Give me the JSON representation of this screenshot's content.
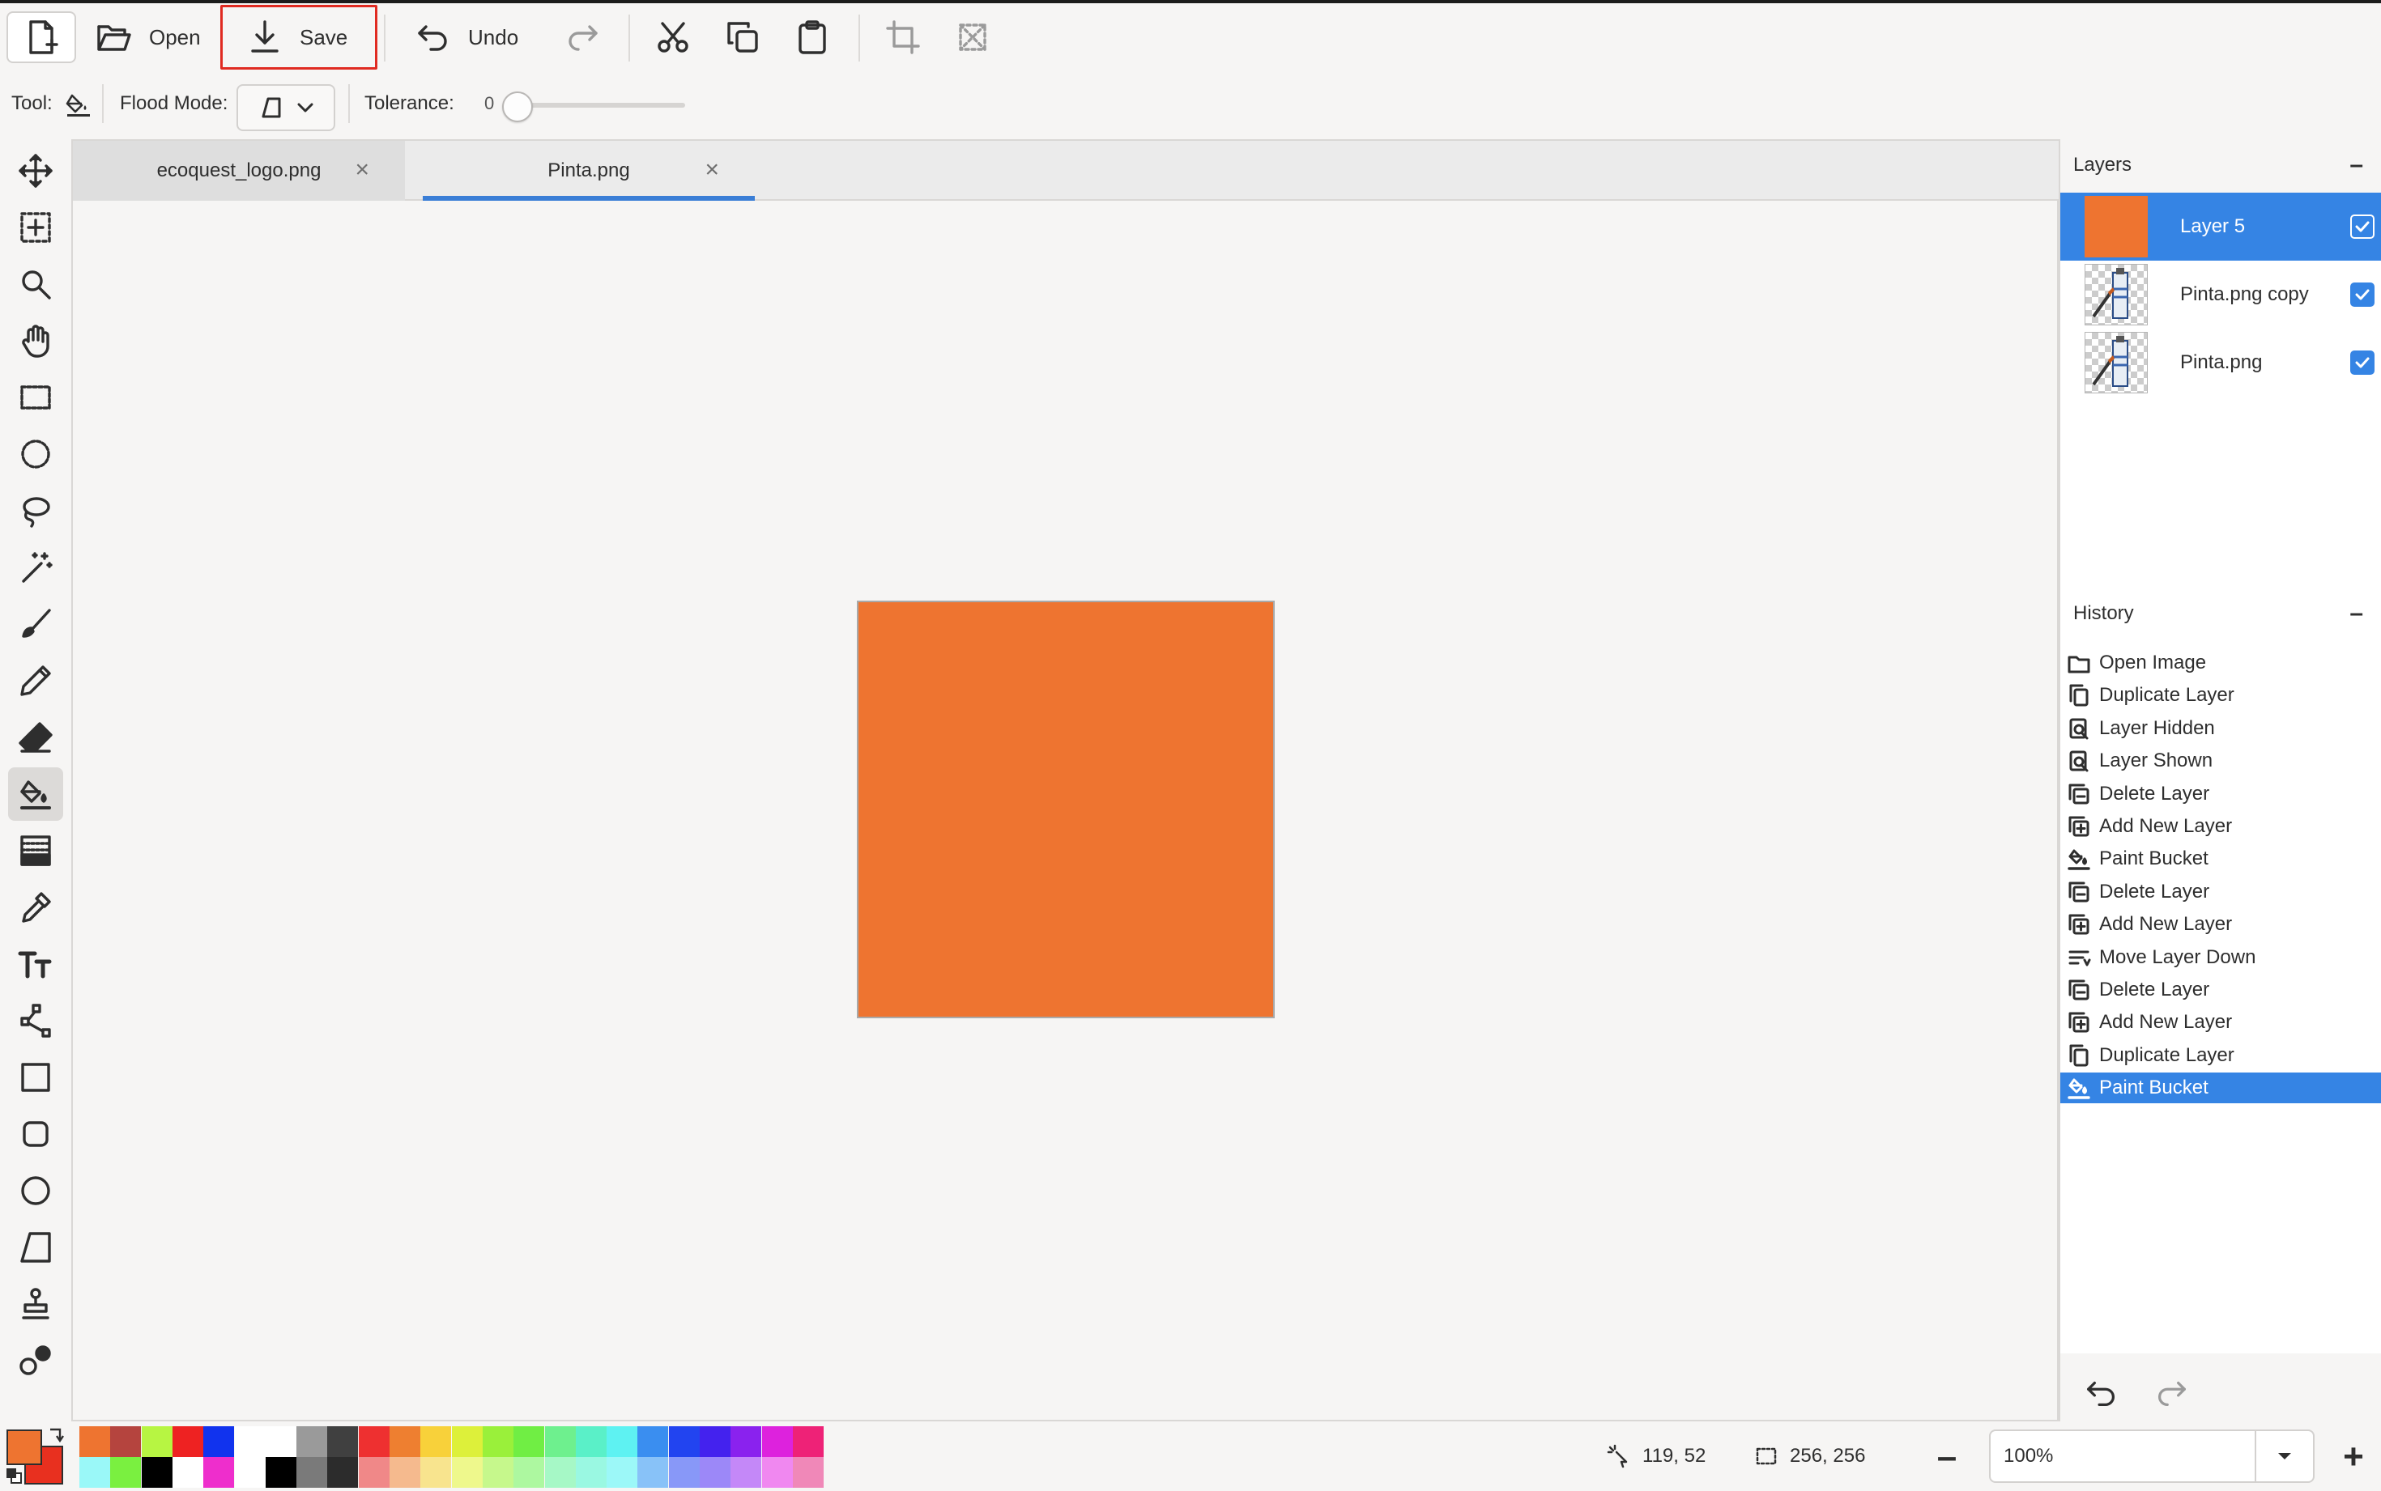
{
  "toolbar": {
    "new_label": "",
    "open_label": "Open",
    "save_label": "Save",
    "undo_label": "Undo"
  },
  "options": {
    "tool_label": "Tool:",
    "flood_mode_label": "Flood Mode:",
    "tolerance_label": "Tolerance:",
    "tolerance_value": "0",
    "tolerance_fraction": 0
  },
  "tabs": [
    {
      "label": "ecoquest_logo.png",
      "active": false
    },
    {
      "label": "Pinta.png",
      "active": true
    }
  ],
  "canvas": {
    "image_color": "#ee7430"
  },
  "layers": {
    "title": "Layers",
    "collapse": "–",
    "items": [
      {
        "name": "Layer 5",
        "selected": true,
        "visible": true
      },
      {
        "name": "Pinta.png copy",
        "selected": false,
        "visible": true
      },
      {
        "name": "Pinta.png",
        "selected": false,
        "visible": true
      }
    ]
  },
  "history": {
    "title": "History",
    "collapse": "–",
    "items": [
      {
        "label": "Open Image",
        "icon": "folder-icon"
      },
      {
        "label": "Duplicate Layer",
        "icon": "duplicate-icon"
      },
      {
        "label": "Layer Hidden",
        "icon": "layer-properties-icon"
      },
      {
        "label": "Layer Shown",
        "icon": "layer-properties-icon"
      },
      {
        "label": "Delete Layer",
        "icon": "delete-layer-icon"
      },
      {
        "label": "Add New Layer",
        "icon": "add-layer-icon"
      },
      {
        "label": "Paint Bucket",
        "icon": "paint-bucket-icon"
      },
      {
        "label": "Delete Layer",
        "icon": "delete-layer-icon"
      },
      {
        "label": "Add New Layer",
        "icon": "add-layer-icon"
      },
      {
        "label": "Move Layer Down",
        "icon": "move-down-icon"
      },
      {
        "label": "Delete Layer",
        "icon": "delete-layer-icon"
      },
      {
        "label": "Add New Layer",
        "icon": "add-layer-icon"
      },
      {
        "label": "Duplicate Layer",
        "icon": "duplicate-icon"
      },
      {
        "label": "Paint Bucket",
        "icon": "paint-bucket-icon",
        "selected": true
      }
    ]
  },
  "colors": {
    "primary": "#ee7430",
    "secondary": "#e8301f",
    "accent": "#3584e4",
    "palette_top": [
      "#ee7430",
      "#b5443e",
      "#b7f542",
      "#ee2222",
      "#1133ee",
      "#ffffff",
      "#ffffff",
      "#9a9a9a",
      "#404040",
      "#ee3030",
      "#ee7f30",
      "#f8d13a",
      "#ddf03a",
      "#9af03a",
      "#70ee44",
      "#6ef08e",
      "#5af0c8",
      "#5ef2f2",
      "#3a8ef0",
      "#2244f0",
      "#4422ee",
      "#8a22ee",
      "#dd22dd",
      "#ee2277"
    ],
    "palette_bottom": [
      "#9af8f8",
      "#7af040",
      "#000000",
      "#ffffff",
      "#ee2ecc",
      "#ffffff",
      "#000000",
      "#7a7a7a",
      "#2c2c2c",
      "#f08888",
      "#f5ba8e",
      "#f8e48e",
      "#eef88c",
      "#c6f88c",
      "#adf8a0",
      "#a6f8c6",
      "#9af8e2",
      "#9cf8f8",
      "#88c2f8",
      "#8898f8",
      "#9c88f8",
      "#c488f8",
      "#f088f0",
      "#f088b8"
    ]
  },
  "status": {
    "cursor_position": "119, 52",
    "selection_size": "256, 256",
    "zoom": "100%"
  }
}
